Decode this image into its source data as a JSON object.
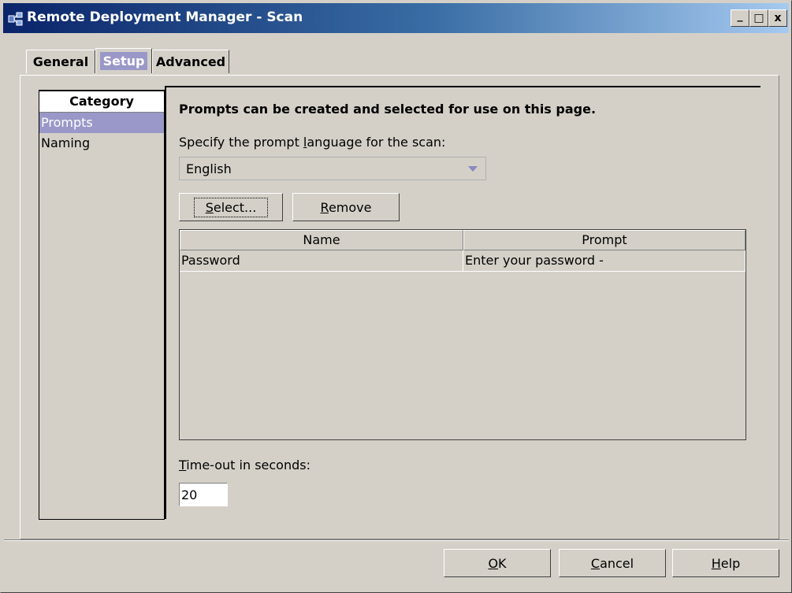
{
  "window": {
    "title": "Remote Deployment Manager - Scan",
    "minimize_label": "_",
    "maximize_label": "□",
    "close_label": "x"
  },
  "tabs": [
    {
      "label": "General",
      "active": false
    },
    {
      "label": "Setup",
      "active": true
    },
    {
      "label": "Advanced",
      "active": false
    }
  ],
  "category": {
    "header": "Category",
    "items": [
      {
        "label": "Prompts",
        "selected": true
      },
      {
        "label": "Naming",
        "selected": false
      }
    ]
  },
  "main": {
    "heading": "Prompts can be created and selected for use on this page.",
    "language_label_pre": "Specify the prompt ",
    "language_label_u": "l",
    "language_label_post": "anguage for the scan:",
    "language_value": "English",
    "select_button_u": "S",
    "select_button_rest": "elect...",
    "remove_button_u": "R",
    "remove_button_rest": "emove",
    "table": {
      "columns": [
        "Name",
        "Prompt"
      ],
      "rows": [
        [
          "Password",
          "Enter your password -"
        ]
      ]
    },
    "timeout_label_u": "T",
    "timeout_label_rest": "ime-out in seconds:",
    "timeout_value": "20"
  },
  "footer": {
    "ok_u": "O",
    "ok_rest": "K",
    "cancel_u": "C",
    "cancel_rest": "ancel",
    "help_u": "H",
    "help_rest": "elp"
  },
  "colors": {
    "title_start": "#0a246a",
    "title_end": "#a6caf0",
    "selection": "#9a98c8",
    "face": "#d4d0c8"
  }
}
